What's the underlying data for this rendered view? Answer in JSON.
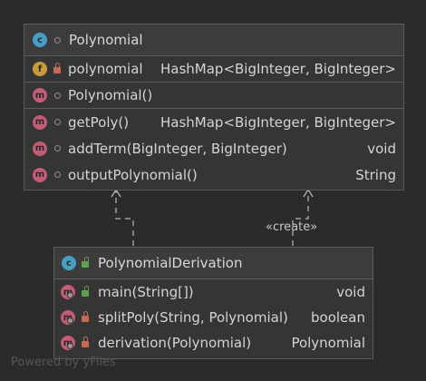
{
  "polynomial_class": {
    "name": "Polynomial",
    "field": {
      "name": "polynomial",
      "type": "HashMap<BigInteger, BigInteger>"
    },
    "constructor": {
      "name": "Polynomial()"
    },
    "methods": [
      {
        "name": "getPoly()",
        "type": "HashMap<BigInteger, BigInteger>"
      },
      {
        "name": "addTerm(BigInteger, BigInteger)",
        "type": "void"
      },
      {
        "name": "outputPolynomial()",
        "type": "String"
      }
    ]
  },
  "derivation_class": {
    "name": "PolynomialDerivation",
    "methods": [
      {
        "name": "main(String[])",
        "type": "void"
      },
      {
        "name": "splitPoly(String, Polynomial)",
        "type": "boolean"
      },
      {
        "name": "derivation(Polynomial)",
        "type": "Polynomial"
      }
    ]
  },
  "relation_label": "«create»",
  "footer": "Powered by yFiles",
  "badges": {
    "class": "c",
    "field": "f",
    "method": "m"
  }
}
